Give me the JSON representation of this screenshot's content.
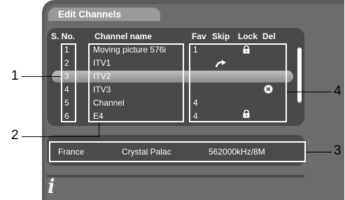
{
  "title": "Edit Channels",
  "columns": {
    "sno": "S. No.",
    "name": "Channel name",
    "fav": "Fav",
    "skip": "Skip",
    "lock": "Lock",
    "del": "Del"
  },
  "channels": [
    {
      "sno": "1",
      "name": "Moving picture 576i",
      "fav": "1",
      "skip": false,
      "lock": true,
      "del": false
    },
    {
      "sno": "2",
      "name": "ITV1",
      "fav": "",
      "skip": true,
      "lock": false,
      "del": false
    },
    {
      "sno": "3",
      "name": "ITV2",
      "fav": "",
      "skip": false,
      "lock": false,
      "del": false,
      "selected": true
    },
    {
      "sno": "4",
      "name": "ITV3",
      "fav": "",
      "skip": false,
      "lock": false,
      "del": true
    },
    {
      "sno": "5",
      "name": "Channel",
      "fav": "4",
      "skip": false,
      "lock": false,
      "del": false
    },
    {
      "sno": "6",
      "name": "E4",
      "fav": "4",
      "skip": false,
      "lock": true,
      "del": false
    }
  ],
  "info": {
    "country": "France",
    "transmitter": "Crystal Palac",
    "frequency": "562000kHz/8M"
  },
  "callouts": [
    "1",
    "2",
    "3",
    "4"
  ],
  "icons": {
    "lock": "lock-icon",
    "skip": "skip-arrow-icon",
    "del": "delete-x-icon",
    "info": "info-icon"
  },
  "colors": {
    "frame": "#5d5d5d",
    "panel": "#494949",
    "highlight": "#a8a8a8",
    "text": "#ffffff"
  }
}
